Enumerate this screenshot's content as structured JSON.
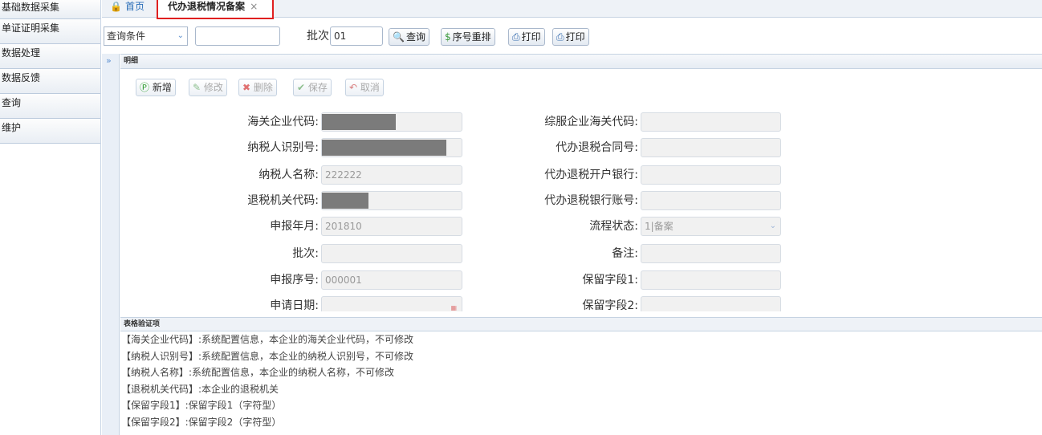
{
  "sidebar": {
    "items": [
      {
        "label": "基础数据采集"
      },
      {
        "label": "单证证明采集"
      },
      {
        "label": "数据处理"
      },
      {
        "label": "数据反馈"
      },
      {
        "label": "查询"
      },
      {
        "label": "维护"
      }
    ]
  },
  "tabs": {
    "home_label": "首页",
    "active_label": "代办退税情况备案",
    "close_glyph": "×"
  },
  "query": {
    "condition_select": "查询条件",
    "condition_value": "",
    "batch_label": "批次:",
    "batch_value": "01",
    "btn_query": "查询",
    "btn_reorder": "序号重排",
    "btn_print1": "打印",
    "btn_print2": "打印"
  },
  "detail": {
    "panel_title": "明细",
    "toggle_glyph": "»",
    "crud": {
      "add": "新增",
      "edit": "修改",
      "delete": "删除",
      "save": "保存",
      "cancel": "取消"
    },
    "left": [
      {
        "label": "海关企业代码:",
        "value": ""
      },
      {
        "label": "纳税人识别号:",
        "value": ""
      },
      {
        "label": "纳税人名称:",
        "value": "222222"
      },
      {
        "label": "退税机关代码:",
        "value": ""
      },
      {
        "label": "申报年月:",
        "value": "201810"
      },
      {
        "label": "批次:",
        "value": ""
      },
      {
        "label": "申报序号:",
        "value": "000001"
      },
      {
        "label": "申请日期:",
        "value": ""
      }
    ],
    "right": [
      {
        "label": "综服企业海关代码:",
        "value": ""
      },
      {
        "label": "代办退税合同号:",
        "value": ""
      },
      {
        "label": "代办退税开户银行:",
        "value": ""
      },
      {
        "label": "代办退税银行账号:",
        "value": ""
      },
      {
        "label": "流程状态:",
        "value": "1|备案"
      },
      {
        "label": "备注:",
        "value": ""
      },
      {
        "label": "保留字段1:",
        "value": ""
      },
      {
        "label": "保留字段2:",
        "value": ""
      }
    ]
  },
  "validation": {
    "title": "表格验证项",
    "lines": [
      "【海关企业代码】:系统配置信息，本企业的海关企业代码，不可修改",
      "【纳税人识别号】:系统配置信息，本企业的纳税人识别号，不可修改",
      "【纳税人名称】:系统配置信息，本企业的纳税人名称，不可修改",
      "【退税机关代码】:本企业的退税机关",
      "【保留字段1】:保留字段1（字符型）",
      "【保留字段2】:保留字段2（字符型）"
    ]
  },
  "colors": {
    "active_tab_border": "#e02020",
    "link_blue": "#2a6db8",
    "mask_gray": "#7b7b7b"
  }
}
